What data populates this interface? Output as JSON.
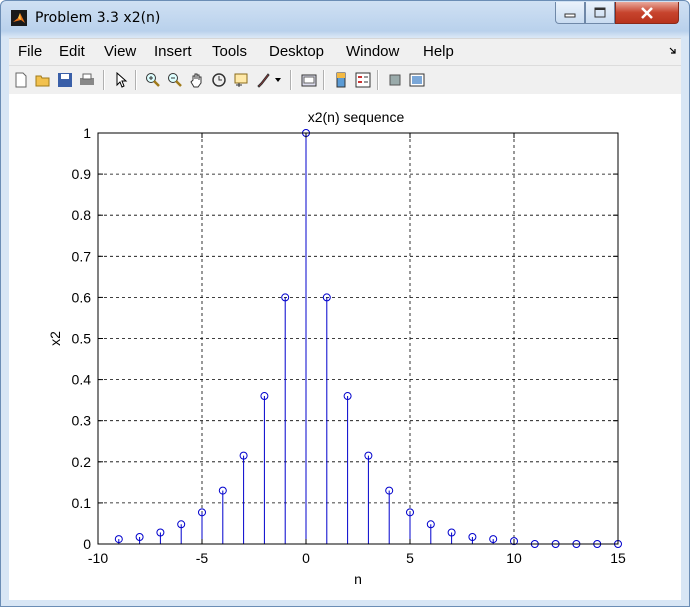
{
  "window": {
    "title": "Problem 3.3 x2(n)"
  },
  "menu": [
    "File",
    "Edit",
    "View",
    "Insert",
    "Tools",
    "Desktop",
    "Window",
    "Help"
  ],
  "toolbar": {
    "icons": [
      "new-figure-icon",
      "open-file-icon",
      "save-icon",
      "print-icon",
      "pointer-icon",
      "zoom-in-icon",
      "zoom-out-icon",
      "pan-icon",
      "rotate-3d-icon",
      "data-cursor-icon",
      "brush-icon",
      "link-plot-icon",
      "colorbar-icon",
      "legend-icon",
      "hide-plot-tools-icon",
      "show-plot-tools-icon"
    ]
  },
  "colors": {
    "stem": "#0000cc",
    "axes": "#000000",
    "grid": "#000000"
  },
  "chart_data": {
    "type": "stem",
    "title": "x2(n) sequence",
    "xlabel": "n",
    "ylabel": "x2",
    "xlim": [
      -10,
      15
    ],
    "ylim": [
      0,
      1
    ],
    "grid": true,
    "xticks": [
      "-10",
      "-5",
      "0",
      "5",
      "10",
      "15"
    ],
    "yticks": [
      "0",
      "0.1",
      "0.2",
      "0.3",
      "0.4",
      "0.5",
      "0.6",
      "0.7",
      "0.8",
      "0.9",
      "1"
    ],
    "x": [
      -9,
      -8,
      -7,
      -6,
      -5,
      -4,
      -3,
      -2,
      -1,
      0,
      1,
      2,
      3,
      4,
      5,
      6,
      7,
      8,
      9,
      10,
      11,
      12,
      13,
      14,
      15
    ],
    "values": [
      0.012,
      0.017,
      0.028,
      0.048,
      0.077,
      0.13,
      0.215,
      0.36,
      0.6,
      1,
      0.6,
      0.36,
      0.215,
      0.13,
      0.077,
      0.048,
      0.028,
      0.017,
      0.012,
      0.007,
      0,
      0,
      0,
      0,
      0
    ]
  }
}
